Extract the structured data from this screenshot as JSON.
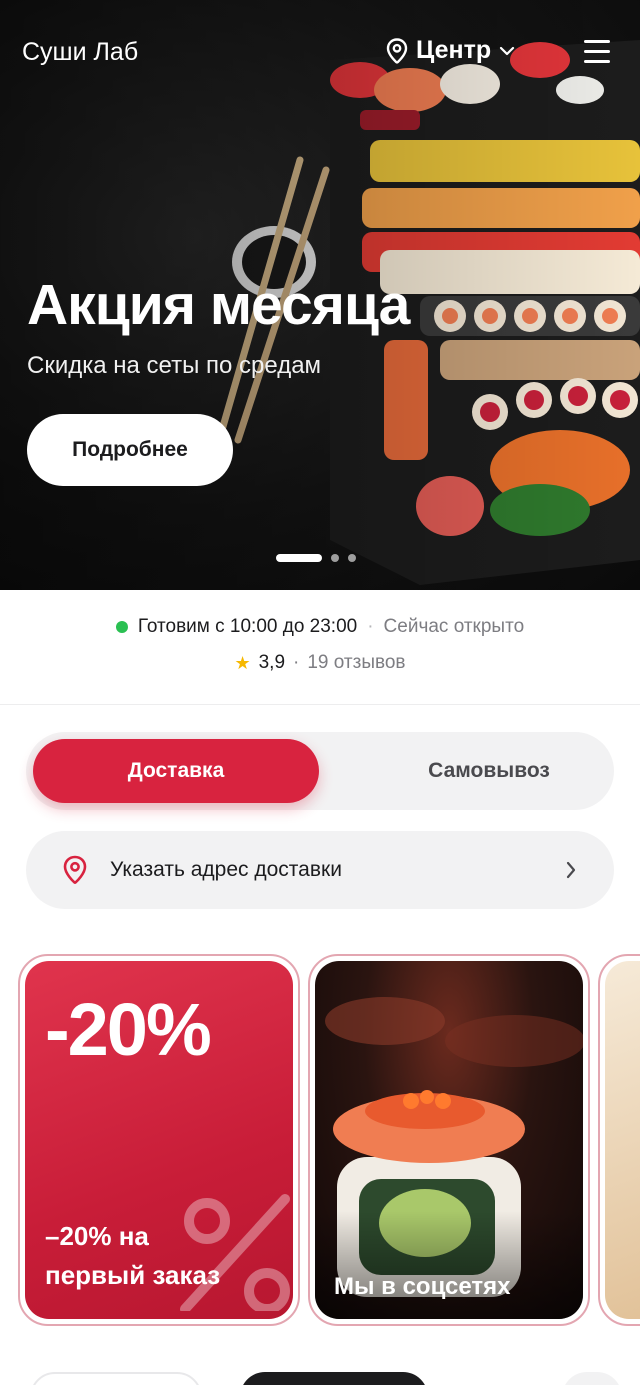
{
  "header": {
    "brand": "Суши Лаб",
    "location": "Центр"
  },
  "hero": {
    "title": "Акция месяца",
    "subtitle": "Скидка на сеты по средам",
    "cta": "Подробнее",
    "slides_total": 3,
    "slide_active": 1
  },
  "status": {
    "hours": "Готовим с 10:00 до 23:00",
    "open_state": "Сейчас открыто",
    "separator": "·",
    "rating": "3,9",
    "reviews": "19 отзывов"
  },
  "order_mode": {
    "delivery": "Доставка",
    "pickup": "Самовывоз",
    "selected": "Доставка"
  },
  "address": {
    "label": "Указать адрес доставки"
  },
  "stories": [
    {
      "headline": "-20%",
      "caption_line1": "–20% на",
      "caption_line2": "первый заказ"
    },
    {
      "caption": "Мы в соцсетях"
    }
  ],
  "colors": {
    "accent": "#d8233f",
    "open_dot": "#2ac052",
    "star": "#f6b800"
  }
}
